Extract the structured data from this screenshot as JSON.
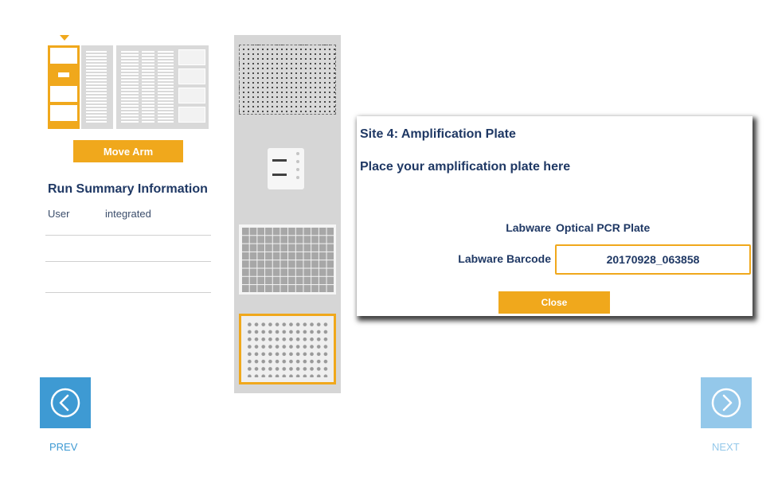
{
  "left_panel": {
    "move_arm_label": "Move Arm",
    "summary_title": "Run Summary Information",
    "summary_rows": [
      {
        "key": "User",
        "value": "integrated"
      },
      {
        "key": "",
        "value": ""
      },
      {
        "key": "",
        "value": ""
      }
    ]
  },
  "dialog": {
    "title": "Site 4: Amplification Plate",
    "instruction": "Place your amplification plate here",
    "labware_label": "Labware",
    "labware_value": "Optical PCR Plate",
    "barcode_label": "Labware Barcode",
    "barcode_value": "20170928_063858",
    "close_label": "Close"
  },
  "navigation": {
    "prev_label": "PREV",
    "next_label": "NEXT"
  },
  "icons": {
    "prev": "chevron-left-circle-icon",
    "next": "chevron-right-circle-icon"
  },
  "colors": {
    "accent": "#f0a81c",
    "primary_text": "#1f3864",
    "nav_active": "#3e9ad3",
    "nav_disabled": "#94c8ea",
    "deck_background": "#d6d6d6"
  }
}
